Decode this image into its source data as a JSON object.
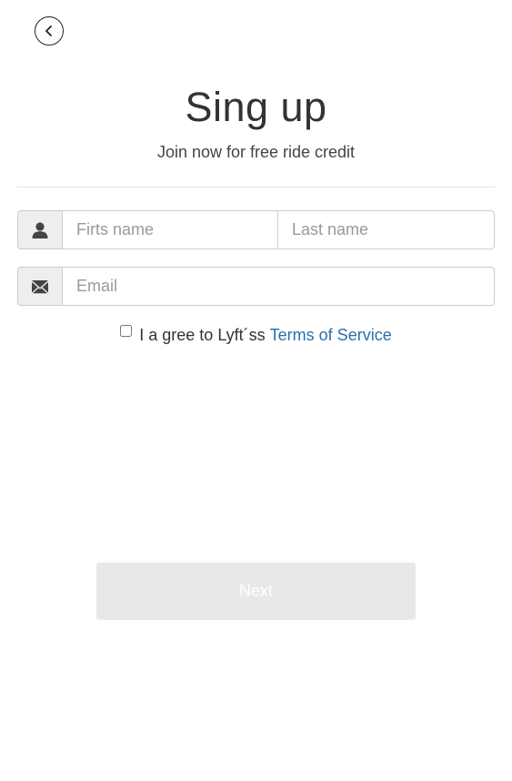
{
  "header": {
    "back_icon": "chevron-left-icon",
    "title": "Sing up",
    "subtitle": "Join now for free ride credit"
  },
  "form": {
    "name_icon": "user-icon",
    "first_name": {
      "placeholder": "Firts name",
      "value": ""
    },
    "last_name": {
      "placeholder": "Last name",
      "value": ""
    },
    "email_icon": "envelope-icon",
    "email": {
      "placeholder": "Email",
      "value": ""
    },
    "terms": {
      "checked": false,
      "text": "I a gree to Lyft´ss",
      "link_label": "Terms of Service"
    },
    "next_label": "Next"
  },
  "colors": {
    "link": "#2a6fa8",
    "addon_bg": "#eeeeee",
    "border": "#cccccc",
    "button_disabled_bg": "#e8e8e8"
  }
}
